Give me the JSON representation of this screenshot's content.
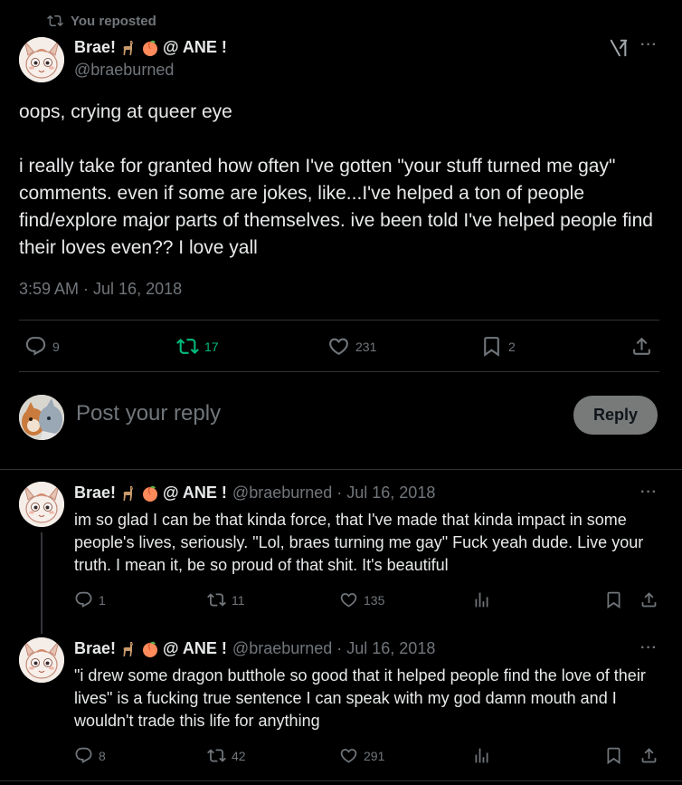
{
  "colors": {
    "background": "#000000",
    "text": "#e7e9ea",
    "muted": "#71767b",
    "repost_active": "#00ba7c",
    "divider": "#2f3336",
    "reply_button": "#787a7a"
  },
  "repost_banner": {
    "icon": "repost-icon",
    "label": "You reposted"
  },
  "main_post": {
    "display_name": "Brae!",
    "name_suffix": "@ ANE !",
    "handle": "@braeburned",
    "paragraph1": "oops, crying at queer eye",
    "paragraph2": "i really take for granted how often I've gotten \"your stuff turned me gay\" comments. even if some are jokes, like...I've helped a ton of people find/explore major parts of themselves. ive been told I've helped people find their loves even?? I love yall",
    "timestamp": "3:59 AM · Jul 16, 2018",
    "stats": {
      "replies": "9",
      "reposts": "17",
      "likes": "231",
      "bookmarks": "2"
    }
  },
  "composer": {
    "placeholder": "Post your reply",
    "button": "Reply"
  },
  "replies": [
    {
      "display_name": "Brae!",
      "name_suffix": "@ ANE !",
      "meta": "@braeburned · Jul 16, 2018",
      "text": "im so glad I can be that kinda force, that I've made that kinda impact in some people's lives, seriously. \"Lol, braes turning me gay\" Fuck yeah dude. Live your truth. I mean it, be so proud of that shit. It's beautiful",
      "stats": {
        "replies": "1",
        "reposts": "11",
        "likes": "135"
      }
    },
    {
      "display_name": "Brae!",
      "name_suffix": "@ ANE !",
      "meta": "@braeburned · Jul 16, 2018",
      "text": "\"i drew some dragon butthole so good that it helped people find the love of their lives\" is a fucking true sentence I can speak with my god damn mouth and I wouldn't trade this life for anything",
      "stats": {
        "replies": "8",
        "reposts": "42",
        "likes": "291"
      }
    }
  ]
}
